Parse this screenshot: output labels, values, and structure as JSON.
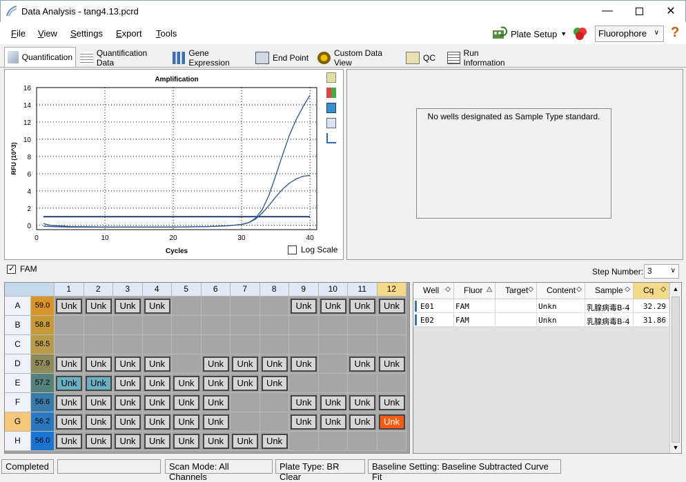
{
  "window": {
    "title": "Data Analysis - tang4.13.pcrd"
  },
  "menu": [
    "File",
    "View",
    "Settings",
    "Export",
    "Tools"
  ],
  "toolbar": {
    "plate_setup": "Plate Setup",
    "fluorophore": "Fluorophore"
  },
  "tabs": [
    "Quantification",
    "Quantification Data",
    "Gene Expression",
    "End Point",
    "Custom Data View",
    "QC",
    "Run Information"
  ],
  "chart": {
    "log_scale_label": "Log Scale",
    "chart_data": {
      "type": "line",
      "title": "Amplification",
      "xlabel": "Cycles",
      "ylabel": "RFU (10^3)",
      "xlim": [
        0,
        41
      ],
      "ylim": [
        -0.5,
        16
      ],
      "xticks": [
        0,
        10,
        20,
        30,
        40
      ],
      "yticks": [
        0,
        2,
        4,
        6,
        8,
        10,
        12,
        14,
        16
      ],
      "grid": true,
      "series": [
        {
          "x": [
            1,
            2,
            5,
            10,
            15,
            20,
            25,
            28,
            30,
            31,
            32,
            33,
            34,
            35,
            36,
            37,
            38,
            39,
            40
          ],
          "y": [
            -0.1,
            -0.15,
            -0.2,
            -0.2,
            -0.2,
            -0.2,
            -0.15,
            -0.05,
            0.1,
            0.3,
            0.8,
            1.8,
            3.5,
            5.8,
            8.2,
            10.5,
            12.3,
            13.8,
            15.1
          ]
        },
        {
          "x": [
            1,
            2,
            5,
            10,
            15,
            20,
            25,
            28,
            30,
            31,
            32,
            33,
            34,
            35,
            36,
            37,
            38,
            39,
            40
          ],
          "y": [
            0.2,
            0.0,
            -0.15,
            -0.2,
            -0.2,
            -0.2,
            -0.15,
            -0.05,
            0.1,
            0.3,
            0.7,
            1.4,
            2.3,
            3.3,
            4.2,
            4.9,
            5.4,
            5.7,
            5.8
          ]
        }
      ],
      "threshold": 1.0
    }
  },
  "std_message": "No wells designated as Sample Type standard.",
  "fam_label": "FAM",
  "step": {
    "label": "Step Number:",
    "value": "3"
  },
  "plate": {
    "cols": [
      "1",
      "2",
      "3",
      "4",
      "5",
      "6",
      "7",
      "8",
      "9",
      "10",
      "11",
      "12"
    ],
    "rows": [
      {
        "r": "A",
        "t": "59.0",
        "c": "#d8962a",
        "wells": [
          1,
          1,
          1,
          1,
          0,
          0,
          0,
          0,
          1,
          1,
          1,
          1
        ]
      },
      {
        "r": "B",
        "t": "58.8",
        "c": "#c79a3a",
        "wells": [
          0,
          0,
          0,
          0,
          0,
          0,
          0,
          0,
          0,
          0,
          0,
          0
        ]
      },
      {
        "r": "C",
        "t": "58.5",
        "c": "#b79a4a",
        "wells": [
          0,
          0,
          0,
          0,
          0,
          0,
          0,
          0,
          0,
          0,
          0,
          0
        ]
      },
      {
        "r": "D",
        "t": "57.9",
        "c": "#8f8a5a",
        "wells": [
          1,
          1,
          1,
          1,
          0,
          1,
          1,
          1,
          1,
          0,
          1,
          1
        ]
      },
      {
        "r": "E",
        "t": "57.2",
        "c": "#56807a",
        "wells": [
          2,
          2,
          1,
          1,
          1,
          1,
          1,
          1,
          0,
          0,
          0,
          0
        ]
      },
      {
        "r": "F",
        "t": "56.6",
        "c": "#3a7aa8",
        "wells": [
          1,
          1,
          1,
          1,
          1,
          1,
          0,
          0,
          1,
          1,
          1,
          1
        ]
      },
      {
        "r": "G",
        "t": "56.2",
        "c": "#2a78c0",
        "wells": [
          1,
          1,
          1,
          1,
          1,
          1,
          0,
          0,
          1,
          1,
          1,
          3
        ]
      },
      {
        "r": "H",
        "t": "56.0",
        "c": "#1a74d0",
        "wells": [
          1,
          1,
          1,
          1,
          1,
          1,
          1,
          1,
          0,
          0,
          0,
          0
        ]
      }
    ],
    "well_label": "Unk"
  },
  "table": {
    "headers": [
      "Well",
      "Fluor",
      "Target",
      "Content",
      "Sample",
      "Cq"
    ],
    "rows": [
      [
        "E01",
        "FAM",
        "",
        "Unkn",
        "乳腺病毒B-4",
        "32.29"
      ],
      [
        "E02",
        "FAM",
        "",
        "Unkn",
        "乳腺病毒B-4",
        "31.86"
      ]
    ]
  },
  "status": {
    "state": "Completed",
    "scan": "Scan Mode: All Channels",
    "plate": "Plate Type: BR Clear",
    "baseline": "Baseline Setting: Baseline Subtracted Curve Fit"
  }
}
